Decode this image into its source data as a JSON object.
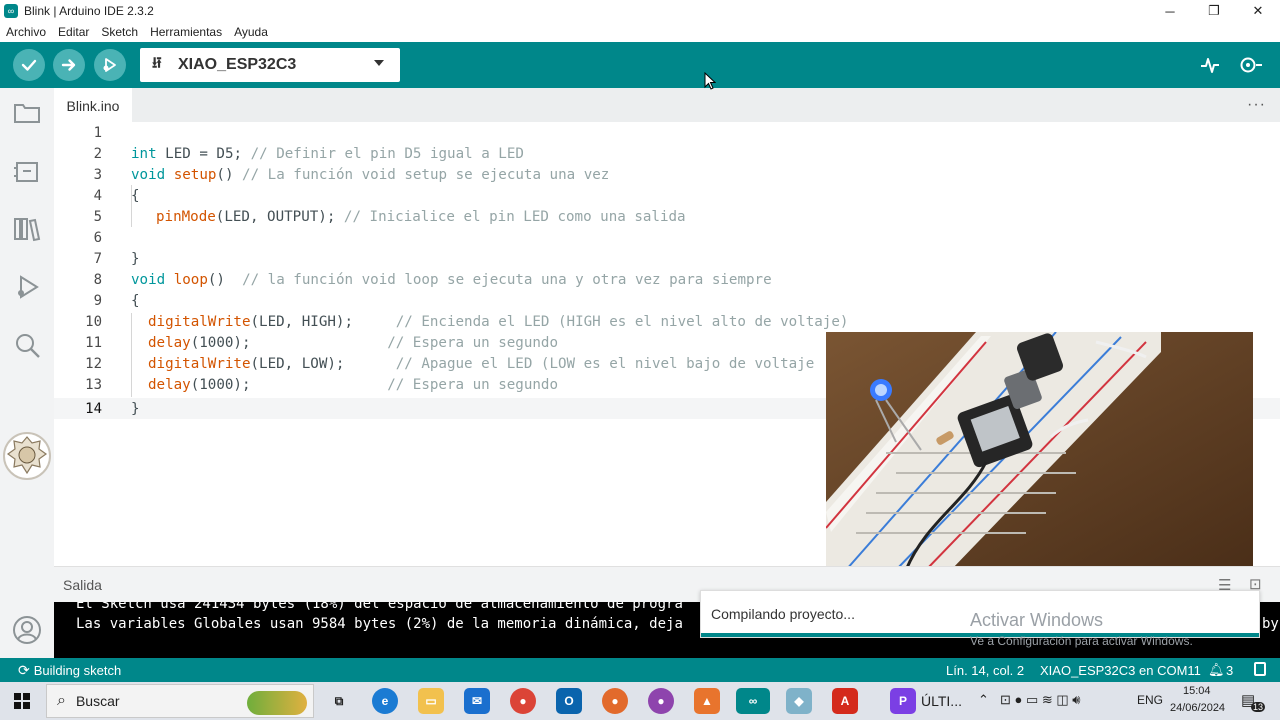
{
  "window": {
    "title": "Blink | Arduino IDE 2.3.2"
  },
  "menu": [
    "Archivo",
    "Editar",
    "Sketch",
    "Herramientas",
    "Ayuda"
  ],
  "toolbar": {
    "board": "XIAO_ESP32C3"
  },
  "tab": {
    "name": "Blink.ino",
    "more": "···"
  },
  "editor": {
    "lines": [
      {
        "n": "1"
      },
      {
        "n": "2"
      },
      {
        "n": "3"
      },
      {
        "n": "4"
      },
      {
        "n": "5"
      },
      {
        "n": "6"
      },
      {
        "n": "7"
      },
      {
        "n": "8"
      },
      {
        "n": "9"
      },
      {
        "n": "10"
      },
      {
        "n": "11"
      },
      {
        "n": "12"
      },
      {
        "n": "13"
      },
      {
        "n": "14"
      }
    ],
    "code": {
      "l2_kw": "int",
      "l2_rest": " LED = D5; ",
      "l2_cm": "// Definir el pin D5 igual a LED",
      "l3_kw": "void",
      "l3_fn": " setup",
      "l3_rest": "() ",
      "l3_cm": "// La función void setup se ejecuta una vez",
      "l4": "{",
      "l5_fn": "pinMode",
      "l5_rest": "(LED, OUTPUT); ",
      "l5_cm": "// Inicialice el pin LED como una salida",
      "l7": "}",
      "l8_kw": "void",
      "l8_fn": " loop",
      "l8_rest": "()  ",
      "l8_cm": "// la función void loop se ejecuta una y otra vez para siempre",
      "l9": "{",
      "l10_fn": "digitalWrite",
      "l10_rest": "(LED, HIGH);     ",
      "l10_cm": "// Encienda el LED (HIGH es el nivel alto de voltaje)",
      "l11_fn": "delay",
      "l11_rest": "(1000);                ",
      "l11_cm": "// Espera un segundo",
      "l12_fn": "digitalWrite",
      "l12_rest": "(LED, LOW);      ",
      "l12_cm": "// Apague el LED (LOW es el nivel bajo de voltaje",
      "l13_fn": "delay",
      "l13_rest": "(1000);                ",
      "l13_cm": "// Espera un segundo",
      "l14": "}"
    }
  },
  "output": {
    "header": "Salida",
    "line1": "El Sketch usa 241434 bytes (18%) del espacio de almacenamiento de progra",
    "line2": "Las variables Globales usan 9584 bytes (2%) de la memoria dinámica, deja",
    "line2_tail": "by"
  },
  "notification": {
    "text": "Compilando proyecto..."
  },
  "watermark": {
    "title": "Activar Windows",
    "subtitle": "Ve a Configuración para activar Windows."
  },
  "status": {
    "left": "Building sketch",
    "position": "Lín. 14, col. 2",
    "board_port": "XIAO_ESP32C3 en COM11",
    "notif_count": "3"
  },
  "taskbar": {
    "search": "Buscar",
    "running_app": "ÚLTI...",
    "lang": "ENG",
    "time": "15:04",
    "date": "24/06/2024",
    "notif_count": "13"
  },
  "colors": {
    "teal": "#00878a",
    "teal_light": "#4ab3b5"
  }
}
